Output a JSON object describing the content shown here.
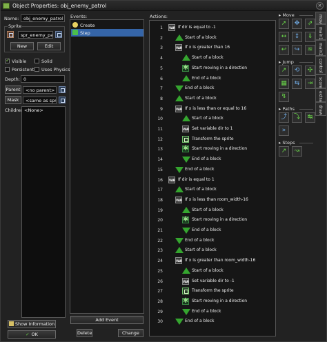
{
  "window": {
    "title": "Object Properties: obj_enemy_patrol",
    "close_glyph": "×"
  },
  "left": {
    "name_label": "Name:",
    "name_value": "obj_enemy_patrol",
    "sprite_group_label": "Sprite",
    "sprite_value": "spr_enemy_patrol",
    "new_label": "New",
    "edit_label": "Edit",
    "visible_label": "Visible",
    "visible_checked": true,
    "solid_label": "Solid",
    "solid_checked": false,
    "persistent_label": "Persistent",
    "persistent_checked": false,
    "uses_physics_label": "Uses Physics",
    "uses_physics_checked": false,
    "depth_label": "Depth:",
    "depth_value": "0",
    "parent_label": "Parent",
    "parent_value": "<no parent>",
    "mask_label": "Mask",
    "mask_value": "<same as sprite>",
    "children_label": "Children:",
    "children_value": "<None>",
    "show_info_label": "Show Information",
    "ok_label": "OK"
  },
  "events": {
    "header": "Events:",
    "items": [
      {
        "label": "Create",
        "icon": "lightbulb-icon",
        "selected": false
      },
      {
        "label": "Step",
        "icon": "step-icon",
        "selected": true
      }
    ],
    "add_label": "Add Event",
    "delete_label": "Delete",
    "change_label": "Change"
  },
  "actions": {
    "header": "Actions:",
    "rows": [
      {
        "n": "1",
        "icon": "vaq",
        "indent": 0,
        "text": "If dir is equal to -1"
      },
      {
        "n": "2",
        "icon": "up",
        "indent": 1,
        "text": "Start of a block"
      },
      {
        "n": "3",
        "icon": "vaq",
        "indent": 1,
        "text": "If x is greater than 16"
      },
      {
        "n": "4",
        "icon": "up",
        "indent": 2,
        "text": "Start of a block"
      },
      {
        "n": "5",
        "icon": "star",
        "indent": 2,
        "text": "Start moving in a direction"
      },
      {
        "n": "6",
        "icon": "up",
        "indent": 2,
        "text": "End of a block"
      },
      {
        "n": "7",
        "icon": "down",
        "indent": 1,
        "text": "End of a block"
      },
      {
        "n": "8",
        "icon": "up",
        "indent": 1,
        "text": "Start of a block"
      },
      {
        "n": "9",
        "icon": "vaq",
        "indent": 1,
        "text": "If x is less than or equal to 16"
      },
      {
        "n": "10",
        "icon": "up",
        "indent": 2,
        "text": "Start of a block"
      },
      {
        "n": "11",
        "icon": "vaq",
        "indent": 2,
        "text": "Set variable dir to 1"
      },
      {
        "n": "12",
        "icon": "xform",
        "indent": 2,
        "text": "Transform the sprite"
      },
      {
        "n": "13",
        "icon": "star",
        "indent": 2,
        "text": "Start moving in a direction"
      },
      {
        "n": "14",
        "icon": "down",
        "indent": 2,
        "text": "End of a block"
      },
      {
        "n": "15",
        "icon": "down",
        "indent": 1,
        "text": "End of a block"
      },
      {
        "n": "16",
        "icon": "vaq",
        "indent": 0,
        "text": "If dir is equal to 1"
      },
      {
        "n": "17",
        "icon": "up",
        "indent": 1,
        "text": "Start of a block"
      },
      {
        "n": "18",
        "icon": "vaq",
        "indent": 1,
        "text": "If x is less than room_width-16"
      },
      {
        "n": "19",
        "icon": "up",
        "indent": 2,
        "text": "Start of a block"
      },
      {
        "n": "20",
        "icon": "star",
        "indent": 2,
        "text": "Start moving in a direction"
      },
      {
        "n": "21",
        "icon": "down",
        "indent": 2,
        "text": "End of a block"
      },
      {
        "n": "22",
        "icon": "down",
        "indent": 1,
        "text": "End of a block"
      },
      {
        "n": "23",
        "icon": "up",
        "indent": 1,
        "text": "Start of a block"
      },
      {
        "n": "24",
        "icon": "vaq",
        "indent": 1,
        "text": "If x is greater than room_width-16"
      },
      {
        "n": "25",
        "icon": "up",
        "indent": 2,
        "text": "Start of a block"
      },
      {
        "n": "26",
        "icon": "vaq",
        "indent": 2,
        "text": "Set variable dir to -1"
      },
      {
        "n": "27",
        "icon": "xform",
        "indent": 2,
        "text": "Transform the sprite"
      },
      {
        "n": "28",
        "icon": "star",
        "indent": 2,
        "text": "Start moving in a direction"
      },
      {
        "n": "29",
        "icon": "down",
        "indent": 2,
        "text": "End of a block"
      },
      {
        "n": "30",
        "icon": "down",
        "indent": 1,
        "text": "End of a block"
      }
    ]
  },
  "palette": {
    "sections": [
      {
        "label": "Move",
        "icons": [
          "move-fixed-icon",
          "move-free-icon",
          "move-towards-icon",
          "speed-horizontal-icon",
          "speed-vertical-icon",
          "set-gravity-icon",
          "reverse-horizontal-icon",
          "reverse-vertical-icon",
          "set-friction-icon"
        ]
      },
      {
        "label": "Jump",
        "icons": [
          "jump-to-position-icon",
          "jump-to-start-icon",
          "jump-to-random-icon",
          "align-to-grid-icon",
          "wrap-screen-icon",
          "move-to-contact-icon",
          "bounce-icon"
        ]
      },
      {
        "label": "Paths",
        "icons": [
          "set-path-icon",
          "end-path-icon",
          "path-position-icon",
          "path-speed-icon"
        ]
      },
      {
        "label": "Steps",
        "icons": [
          "step-towards-icon",
          "step-avoiding-icon"
        ]
      }
    ],
    "section_glyph": "▸"
  },
  "tabs": [
    "move",
    "main1",
    "main2",
    "control",
    "score",
    "extra",
    "draw"
  ]
}
